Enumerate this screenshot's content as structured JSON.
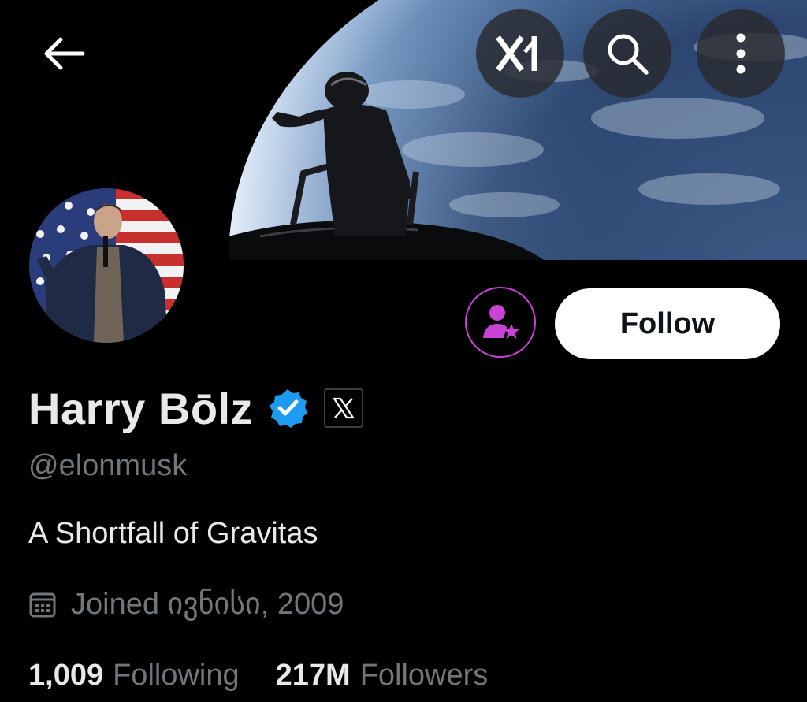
{
  "header": {
    "back_icon": "arrow-left-icon",
    "buttons": [
      {
        "name": "xai-button",
        "icon": "xai-logo-icon"
      },
      {
        "name": "search-button",
        "icon": "search-icon"
      },
      {
        "name": "more-options-button",
        "icon": "more-vertical-icon"
      }
    ]
  },
  "profile": {
    "display_name": "Harry Bōlz",
    "handle": "@elonmusk",
    "bio": "A Shortfall of Gravitas",
    "joined": "Joined ივნისი, 2009",
    "verified_color": "#1d9bf0",
    "affiliation_icon": "x-logo-icon"
  },
  "actions": {
    "subscribe_icon": "person-star-icon",
    "subscribe_color": "#c944d6",
    "follow_label": "Follow"
  },
  "stats": {
    "following_count": "1,009",
    "following_label": "Following",
    "followers_count": "217M",
    "followers_label": "Followers"
  }
}
